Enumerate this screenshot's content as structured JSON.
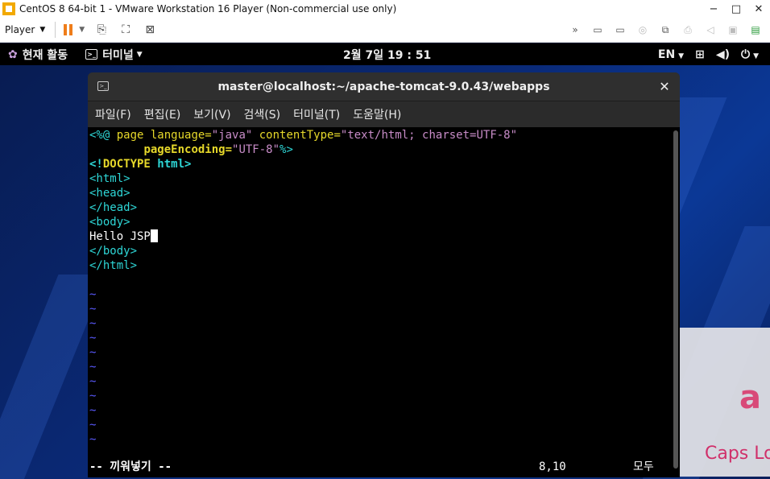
{
  "vmware": {
    "window_title": "CentOS 8 64-bit 1 - VMware Workstation 16 Player (Non-commercial use only)",
    "minimize": "−",
    "maximize": "□",
    "close": "✕",
    "player_label": "Player",
    "accent": "#ef7d1a"
  },
  "gnome": {
    "activities": "현재 활동",
    "app_menu": "터미널",
    "clock": "2월 7일  19 : 51",
    "input_lang": "EN"
  },
  "terminal": {
    "title": "master@localhost:~/apache-tomcat-9.0.43/webapps",
    "close_symbol": "✕",
    "menu": [
      "파일(F)",
      "편집(E)",
      "보기(V)",
      "검색(S)",
      "터미널(T)",
      "도움말(H)"
    ],
    "code": {
      "l1_open": "<%@ ",
      "l1_page": "page ",
      "l1_lang": "language=",
      "l1_lang_val": "\"java\"",
      "l1_ct": " contentType=",
      "l1_ct_val": "\"text/html; charset=UTF-8\"",
      "l2_indent": "        ",
      "l2_pe": "pageEncoding=",
      "l2_pe_val": "\"UTF-8\"",
      "l2_close": "%>",
      "doctype_open": "<!",
      "doctype_word": "DOCTYPE",
      "doctype_rest": " html>",
      "html_open": "<html>",
      "head_open": "<head>",
      "head_close": "</head>",
      "body_open": "<body>",
      "body_text": "Hello JSP",
      "body_close": "</body>",
      "html_close": "</html>",
      "blank": "",
      "tilde": "~"
    },
    "status": {
      "mode": "-- 끼워넣기 --",
      "position": "8,10",
      "scroll": "모두"
    }
  },
  "notification": {
    "partial_text": "a",
    "caps_text": "Caps Lo"
  }
}
